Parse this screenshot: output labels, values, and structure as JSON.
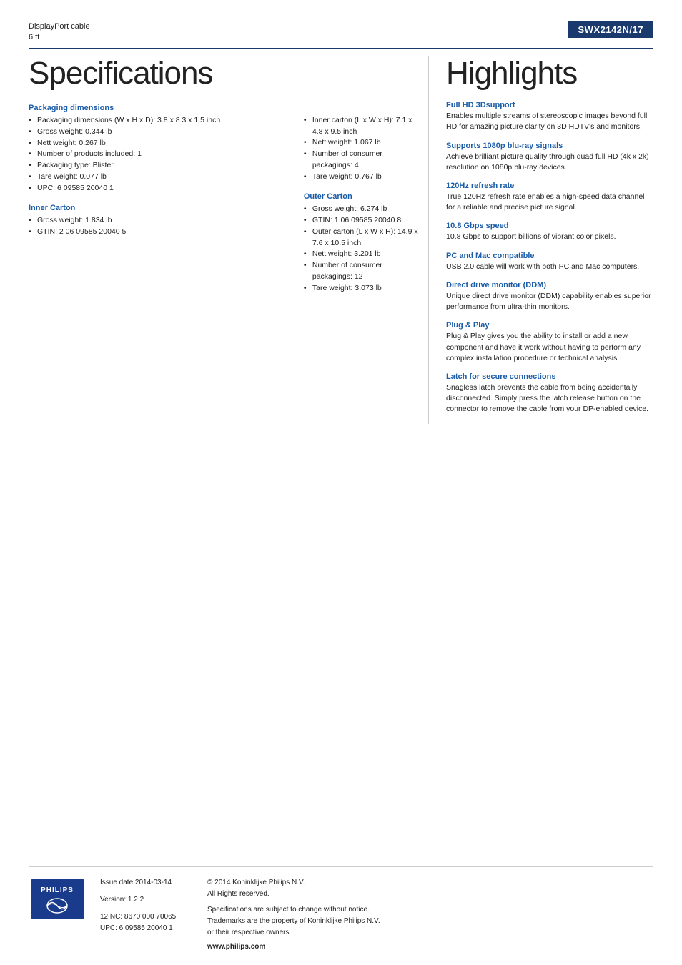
{
  "header": {
    "product_name": "DisplayPort cable",
    "product_size": "6 ft",
    "model_number": "SWX2142N/17"
  },
  "left": {
    "title": "Specifications",
    "packaging_dimensions": {
      "section_title": "Packaging dimensions",
      "items": [
        "Packaging dimensions (W x H x D): 3.8 x 8.3 x 1.5 inch",
        "Gross weight: 0.344 lb",
        "Nett weight: 0.267 lb",
        "Number of products included: 1",
        "Packaging type: Blister",
        "Tare weight: 0.077 lb",
        "UPC: 6 09585 20040 1"
      ]
    },
    "inner_carton": {
      "section_title": "Inner Carton",
      "items": [
        "Gross weight: 1.834 lb",
        "GTIN: 2 06 09585 20040 5"
      ]
    },
    "middle_col": {
      "items": [
        "Inner carton (L x W x H): 7.1 x 4.8 x 9.5 inch",
        "Nett weight: 1.067 lb",
        "Number of consumer packagings: 4",
        "Tare weight: 0.767 lb"
      ]
    },
    "outer_carton": {
      "section_title": "Outer Carton",
      "items": [
        "Gross weight: 6.274 lb",
        "GTIN: 1 06 09585 20040 8",
        "Outer carton (L x W x H): 14.9 x 7.6 x 10.5 inch",
        "Nett weight: 3.201 lb",
        "Number of consumer packagings: 12",
        "Tare weight: 3.073 lb"
      ]
    }
  },
  "right": {
    "title": "Highlights",
    "highlights": [
      {
        "title": "Full HD 3Dsupport",
        "desc": "Enables multiple streams of stereoscopic images beyond full HD for amazing picture clarity on 3D HDTV's and monitors."
      },
      {
        "title": "Supports 1080p blu-ray signals",
        "desc": "Achieve brilliant picture quality through quad full HD (4k x 2k) resolution on 1080p blu-ray devices."
      },
      {
        "title": "120Hz refresh rate",
        "desc": "True 120Hz refresh rate enables a high-speed data channel for a reliable and precise picture signal."
      },
      {
        "title": "10.8 Gbps speed",
        "desc": "10.8 Gbps to support billions of vibrant color pixels."
      },
      {
        "title": "PC and Mac compatible",
        "desc": "USB 2.0 cable will work with both PC and Mac computers."
      },
      {
        "title": "Direct drive monitor (DDM)",
        "desc": "Unique direct drive monitor (DDM) capability enables superior performance from ultra-thin monitors."
      },
      {
        "title": "Plug & Play",
        "desc": "Plug & Play gives you the ability to install or add a new component and have it work without having to perform any complex installation procedure or technical analysis."
      },
      {
        "title": "Latch for secure connections",
        "desc": "Snagless latch prevents the cable from being accidentally disconnected. Simply press the latch release button on the connector to remove the cable from your DP-enabled device."
      }
    ]
  },
  "footer": {
    "issue_label": "Issue date 2014-03-14",
    "version_label": "Version: 1.2.2",
    "nc_upc": "12 NC: 8670 000 70065\nUPC: 6 09585 20040 1",
    "copyright": "© 2014 Koninklijke Philips N.V.\nAll Rights reserved.",
    "disclaimer": "Specifications are subject to change without notice.\nTrademarks are the property of Koninklijke Philips N.V.\nor their respective owners.",
    "website": "www.philips.com"
  }
}
